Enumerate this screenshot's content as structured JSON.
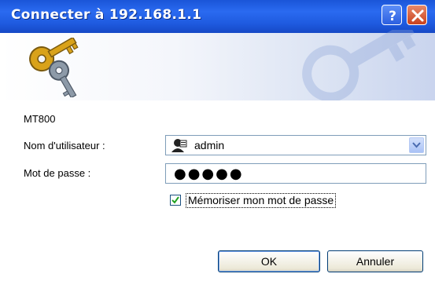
{
  "window": {
    "title": "Connecter à 192.168.1.1",
    "help_icon": "help-icon",
    "close_icon": "close-icon"
  },
  "dialog": {
    "realm": "MT800",
    "username": {
      "label": "Nom d'utilisateur :",
      "value": "admin",
      "icon": "user-icon"
    },
    "password": {
      "label": "Mot de passe :",
      "value": "●●●●●"
    },
    "remember": {
      "label": "Mémoriser mon mot de passe",
      "checked": true
    },
    "buttons": {
      "ok": "OK",
      "cancel": "Annuler"
    }
  },
  "colors": {
    "titlebar": "#2a6af0",
    "close": "#c9411e"
  }
}
